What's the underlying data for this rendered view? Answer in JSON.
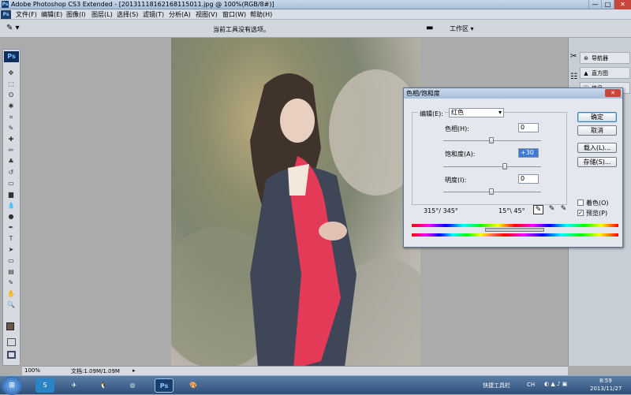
{
  "window": {
    "title": "Adobe Photoshop CS3 Extended - [20131118162168115011.jpg @ 100%(RGB/8#)]",
    "min": "—",
    "max": "□",
    "close": "✕"
  },
  "menubar": {
    "logo": "Ps",
    "items": [
      "文件(F)",
      "编辑(E)",
      "图像(I)",
      "图层(L)",
      "选择(S)",
      "滤镜(T)",
      "分析(A)",
      "视图(V)",
      "窗口(W)",
      "帮助(H)"
    ]
  },
  "optionsbar": {
    "hint": "当前工具没有选项。",
    "workspace": "工作区 ▾"
  },
  "toolbox": {
    "logo": "Ps",
    "tools": [
      "move-tool",
      "marquee-tool",
      "lasso-tool",
      "magic-wand-tool",
      "crop-tool",
      "eyedropper-tool",
      "healing-tool",
      "brush-tool",
      "stamp-tool",
      "history-brush-tool",
      "eraser-tool",
      "gradient-tool",
      "blur-tool",
      "dodge-tool",
      "pen-tool",
      "type-tool",
      "path-select-tool",
      "shape-tool",
      "notes-tool",
      "eyedropper2-tool",
      "hand-tool",
      "zoom-tool"
    ],
    "glyphs": [
      "✥",
      "⬚",
      "ʘ",
      "✱",
      "⌗",
      "✎",
      "✚",
      "✏",
      "♣",
      "↺",
      "▭",
      "▆",
      "💧",
      "●",
      "✒",
      "T",
      "➤",
      "▭",
      "▤",
      "✎",
      "✋",
      "🔍"
    ],
    "fg_color": "#6a5a45",
    "bg_color": "#ffffff"
  },
  "statusbar": {
    "zoom": "100%",
    "doc": "文档:1.09M/1.09M"
  },
  "panels": {
    "items": [
      {
        "icon": "navigator-icon",
        "glyph": "⊛",
        "label": "导航器"
      },
      {
        "icon": "histogram-icon",
        "glyph": "▲",
        "label": "直方图"
      },
      {
        "icon": "info-icon",
        "glyph": "ⓘ",
        "label": "信息"
      }
    ]
  },
  "dialog": {
    "title": "色相/饱和度",
    "close": "✕",
    "edit_label": "编辑(E):",
    "edit_value": "红色",
    "hue_label": "色相(H):",
    "hue_value": "0",
    "saturation_label": "饱和度(A):",
    "saturation_value": "+30",
    "lightness_label": "明度(I):",
    "lightness_value": "0",
    "ok": "确定",
    "cancel": "取消",
    "load": "载入(L)...",
    "save": "存储(S)...",
    "colorize_label": "着色(O)",
    "colorize_checked": false,
    "preview_label": "预览(P)",
    "preview_checked": true,
    "range_left": "315°/ 345°",
    "range_right": "15°\\ 45°"
  },
  "taskbar": {
    "start": "⊞",
    "apps": [
      "sogou-icon",
      "bird-icon",
      "qq-icon",
      "browser-icon",
      "photoshop-icon",
      "paint-icon"
    ],
    "app_glyphs": [
      "S",
      "✈",
      "🐧",
      "◎",
      "Ps",
      "🎨"
    ],
    "toolbar_label": "快捷工具栏",
    "ime": "CH",
    "time": "8:59",
    "date": "2013/11/27"
  }
}
